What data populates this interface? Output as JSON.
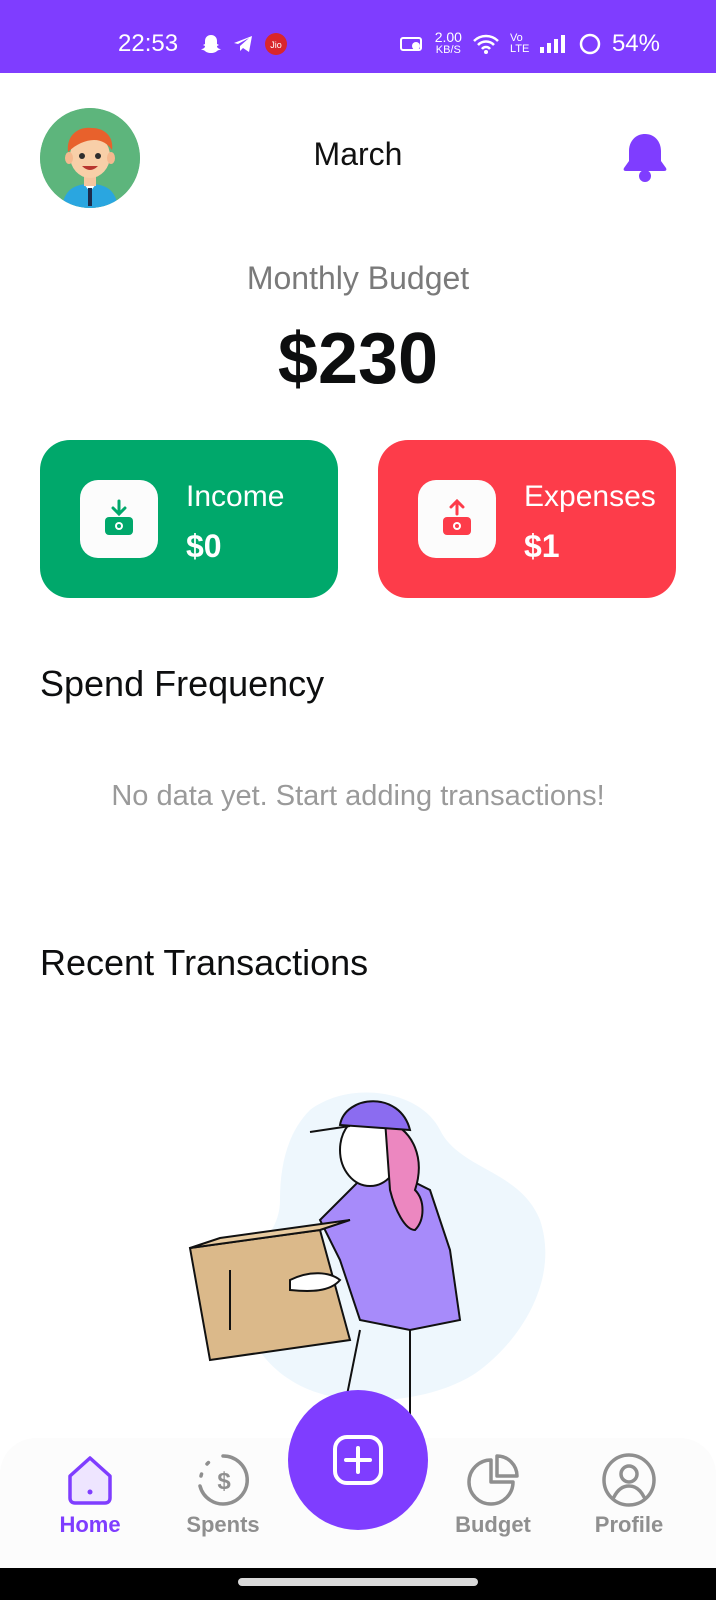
{
  "status_bar": {
    "time": "22:53",
    "net_speed_value": "2.00",
    "net_speed_unit": "KB/S",
    "volte": "Vo LTE",
    "battery": "54%"
  },
  "header": {
    "month": "March"
  },
  "budget": {
    "label": "Monthly Budget",
    "amount": "$230"
  },
  "cards": {
    "income": {
      "label": "Income",
      "value": "$0",
      "color": "#00a86b"
    },
    "expenses": {
      "label": "Expenses",
      "value": "$1",
      "color": "#fd3c4a"
    }
  },
  "spend_frequency": {
    "title": "Spend Frequency",
    "empty_message": "No data yet. Start adding transactions!"
  },
  "recent_transactions": {
    "title": "Recent Transactions"
  },
  "nav": {
    "items": [
      {
        "label": "Home",
        "icon": "home-icon",
        "active": true
      },
      {
        "label": "Spents",
        "icon": "dollar-cycle-icon",
        "active": false
      },
      {
        "label": "Budget",
        "icon": "pie-chart-icon",
        "active": false
      },
      {
        "label": "Profile",
        "icon": "user-icon",
        "active": false
      }
    ],
    "fab_icon": "plus-icon"
  },
  "colors": {
    "accent": "#7f3dff",
    "income": "#00a86b",
    "expenses": "#fd3c4a"
  }
}
